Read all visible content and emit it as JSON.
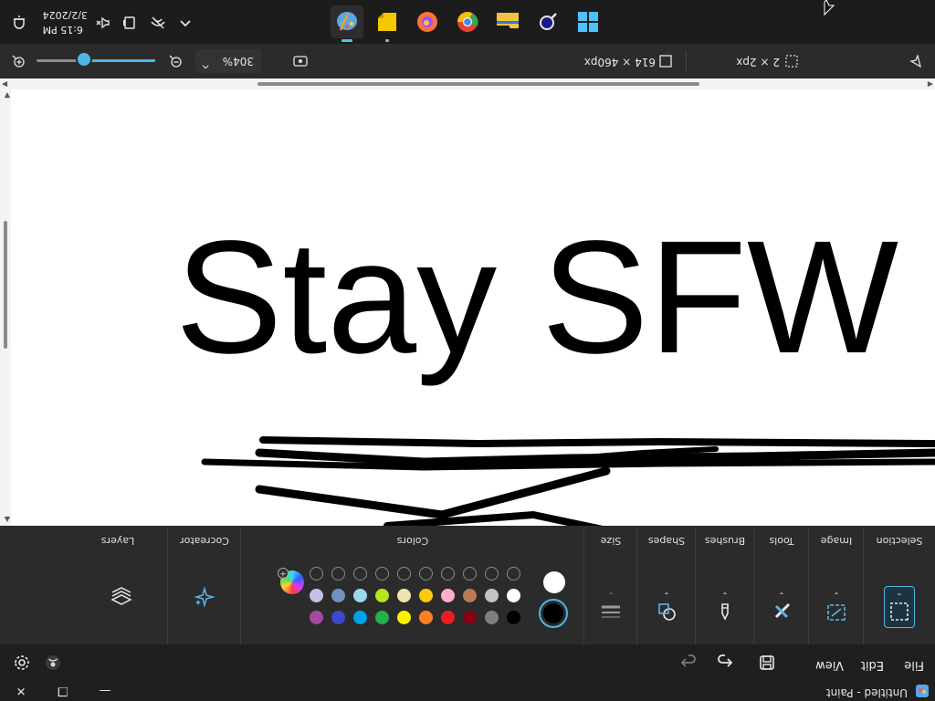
{
  "window": {
    "title": "Untitled - Paint",
    "minimize": "—",
    "maximize": "❐",
    "close": "✕"
  },
  "menu": {
    "file": "File",
    "edit": "Edit",
    "view": "View"
  },
  "ribbon": {
    "groups": {
      "selection": "Selection",
      "image": "Image",
      "tools": "Tools",
      "brushes": "Brushes",
      "shapes": "Shapes",
      "size": "Size",
      "colors": "Colors",
      "cocreator": "Cocreator",
      "layers": "Layers"
    },
    "primary_color": "#000000",
    "secondary_color": "#ffffff",
    "palette_row1": [
      "#000000",
      "#7f7f7f",
      "#880015",
      "#ed1c24",
      "#ff7f27",
      "#fff200",
      "#22b14c",
      "#00a2e8",
      "#3f48cc",
      "#a349a4"
    ],
    "palette_row2": [
      "#ffffff",
      "#c3c3c3",
      "#b97a57",
      "#ffaec9",
      "#ffc90e",
      "#efe4b0",
      "#b5e61d",
      "#99d9ea",
      "#7092be",
      "#c8bfe7"
    ]
  },
  "canvas": {
    "text": "Stay SFW",
    "ink_color": "#000000"
  },
  "status": {
    "selection_size": "2 × 2px",
    "canvas_size": "614 × 460px",
    "zoom": "304%",
    "zoom_level_fraction": 0.6
  },
  "taskbar": {
    "time": "6:15 PM",
    "date": "3/2/2024",
    "chevron": "^"
  }
}
